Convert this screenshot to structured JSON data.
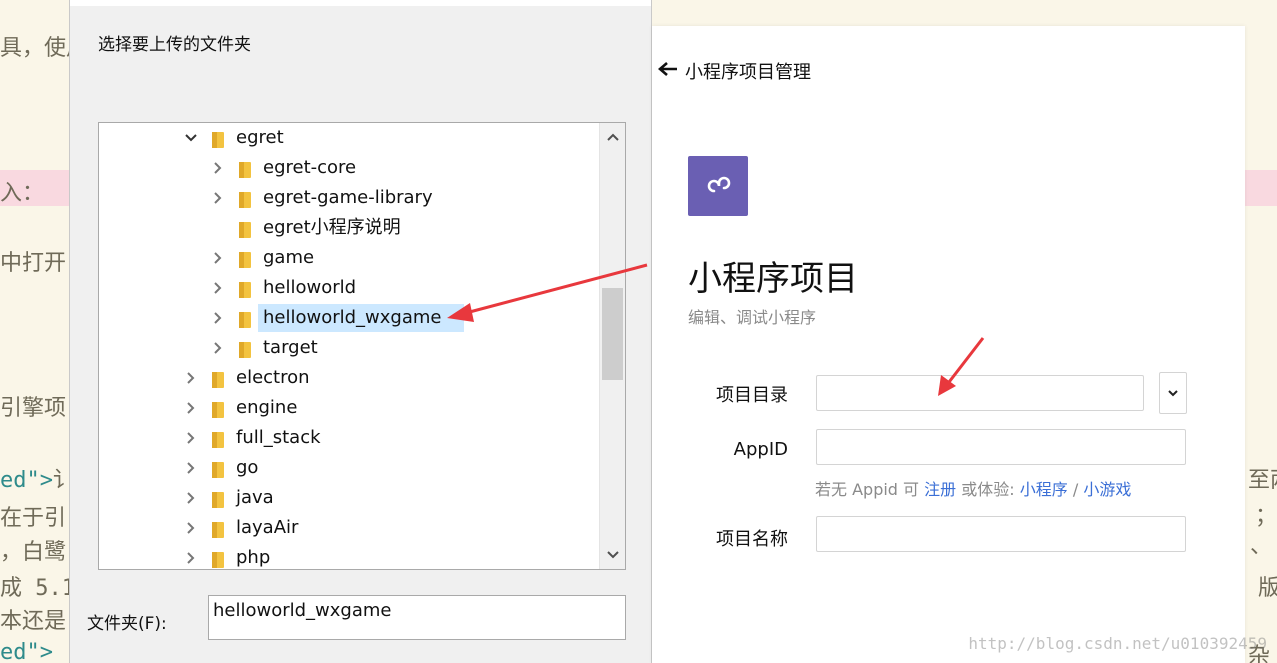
{
  "background": {
    "fragments": [
      "具，使用",
      "入：",
      "中打开",
      "引擎项",
      "ed\">",
      "讠",
      "在于引",
      "，白鹭",
      "成 5.1",
      "本还是",
      "ed\">",
      "至两",
      "；",
      "、",
      "版",
      "杂"
    ],
    "watermark": "http://blog.csdn.net/u010392459"
  },
  "dialog": {
    "prompt": "选择要上传的文件夹",
    "tree": [
      {
        "name": "egret",
        "depth": 0,
        "expander": "expanded"
      },
      {
        "name": "egret-core",
        "depth": 1,
        "expander": "collapsed"
      },
      {
        "name": "egret-game-library",
        "depth": 1,
        "expander": "collapsed"
      },
      {
        "name": "egret小程序说明",
        "depth": 1,
        "expander": "none"
      },
      {
        "name": "game",
        "depth": 1,
        "expander": "collapsed"
      },
      {
        "name": "helloworld",
        "depth": 1,
        "expander": "collapsed"
      },
      {
        "name": "helloworld_wxgame",
        "depth": 1,
        "expander": "collapsed",
        "selected": true
      },
      {
        "name": "target",
        "depth": 1,
        "expander": "collapsed"
      },
      {
        "name": "electron",
        "depth": 0,
        "expander": "collapsed"
      },
      {
        "name": "engine",
        "depth": 0,
        "expander": "collapsed"
      },
      {
        "name": "full_stack",
        "depth": 0,
        "expander": "collapsed"
      },
      {
        "name": "go",
        "depth": 0,
        "expander": "collapsed"
      },
      {
        "name": "java",
        "depth": 0,
        "expander": "collapsed"
      },
      {
        "name": "layaAir",
        "depth": 0,
        "expander": "collapsed"
      },
      {
        "name": "php",
        "depth": 0,
        "expander": "collapsed"
      }
    ],
    "folder_label": "文件夹(F):",
    "folder_value": "helloworld_wxgame"
  },
  "panel": {
    "back_label": "小程序项目管理",
    "title": "小程序项目",
    "subtitle": "编辑、调试小程序",
    "fields": {
      "dir_label": "项目目录",
      "appid_label": "AppID",
      "name_label": "项目名称"
    },
    "hint": {
      "prefix": "若无 Appid 可",
      "register": "注册",
      "middle": "或体验:",
      "mini_program": "小程序",
      "sep": "/",
      "mini_game": "小游戏"
    }
  },
  "colors": {
    "logo_bg": "#6a5fb3",
    "selection": "#cce8ff",
    "link": "#3b6fd6",
    "arrow": "#e8383d",
    "folder": "#f3c340"
  }
}
